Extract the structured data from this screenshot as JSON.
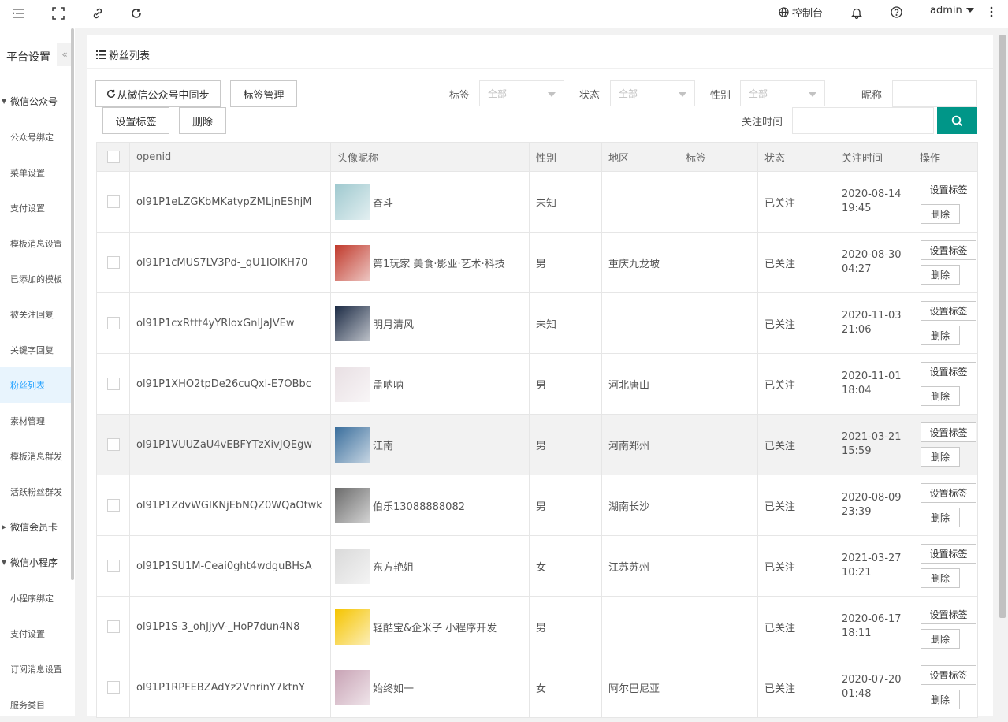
{
  "topbar": {
    "console": "控制台",
    "user": "admin"
  },
  "sidebar": {
    "title": "平台设置",
    "groups": [
      {
        "label": "微信公众号",
        "items": [
          "公众号绑定",
          "菜单设置",
          "支付设置",
          "模板消息设置",
          "已添加的模板",
          "被关注回复",
          "关键字回复",
          "粉丝列表",
          "素材管理",
          "模板消息群发",
          "活跃粉丝群发"
        ]
      },
      {
        "label": "微信会员卡",
        "items": []
      },
      {
        "label": "微信小程序",
        "items": [
          "小程序绑定",
          "支付设置",
          "订阅消息设置",
          "服务类目"
        ]
      }
    ],
    "active": "粉丝列表"
  },
  "panel": {
    "title": "粉丝列表"
  },
  "toolbar": {
    "sync": "从微信公众号中同步",
    "tag_manage": "标签管理",
    "set_tag": "设置标签",
    "delete": "删除"
  },
  "filters": {
    "tag_label": "标签",
    "tag_value": "全部",
    "status_label": "状态",
    "status_value": "全部",
    "gender_label": "性别",
    "gender_value": "全部",
    "nickname_label": "昵称",
    "follow_time_label": "关注时间"
  },
  "table": {
    "headers": [
      "openid",
      "头像昵称",
      "性别",
      "地区",
      "标签",
      "状态",
      "关注时间",
      "操作"
    ],
    "op_set_tag": "设置标签",
    "op_delete": "删除",
    "rows": [
      {
        "openid": "ol91P1eLZGKbMKatypZMLjnEShjM",
        "nickname": "奋斗",
        "gender": "未知",
        "region": "",
        "tag": "",
        "status": "已关注",
        "time": "2020-08-14 19:45",
        "avatar_color": "#9fc9cf"
      },
      {
        "openid": "ol91P1cMUS7LV3Pd-_qU1IOlKH70",
        "nickname": "第1玩家 美食·影业·艺术·科技",
        "gender": "男",
        "region": "重庆九龙坡",
        "tag": "",
        "status": "已关注",
        "time": "2020-08-30 04:27",
        "avatar_color": "#c0392b"
      },
      {
        "openid": "ol91P1cxRttt4yYRloxGnlJaJVEw",
        "nickname": "明月清风",
        "gender": "未知",
        "region": "",
        "tag": "",
        "status": "已关注",
        "time": "2020-11-03 21:06",
        "avatar_color": "#1b2a44"
      },
      {
        "openid": "ol91P1XHO2tpDe26cuQxl-E7OBbc",
        "nickname": "孟呐呐",
        "gender": "男",
        "region": "河北唐山",
        "tag": "",
        "status": "已关注",
        "time": "2020-11-01 18:04",
        "avatar_color": "#e8dfe3"
      },
      {
        "openid": "ol91P1VUUZaU4vEBFYTzXivJQEgw",
        "nickname": "江南",
        "gender": "男",
        "region": "河南郑州",
        "tag": "",
        "status": "已关注",
        "time": "2021-03-21 15:59",
        "avatar_color": "#3a6e9c"
      },
      {
        "openid": "ol91P1ZdvWGIKNjEbNQZ0WQaOtwk",
        "nickname": "伯乐13088888082",
        "gender": "男",
        "region": "湖南长沙",
        "tag": "",
        "status": "已关注",
        "time": "2020-08-09 23:39",
        "avatar_color": "#6b6b6b"
      },
      {
        "openid": "ol91P1SU1M-Ceai0ght4wdguBHsA",
        "nickname": "东方艳姐",
        "gender": "女",
        "region": "江苏苏州",
        "tag": "",
        "status": "已关注",
        "time": "2021-03-27 10:21",
        "avatar_color": "#d9d9d9"
      },
      {
        "openid": "ol91P1S-3_ohJjyV-_HoP7dun4N8",
        "nickname": "轻酷宝&企米子 小程序开发",
        "gender": "男",
        "region": "",
        "tag": "",
        "status": "已关注",
        "time": "2020-06-17 18:11",
        "avatar_color": "#f5c400"
      },
      {
        "openid": "ol91P1RPFEBZAdYz2VnrinY7ktnY",
        "nickname": "始终如一",
        "gender": "女",
        "region": "阿尔巴尼亚",
        "tag": "",
        "status": "已关注",
        "time": "2020-07-20 01:48",
        "avatar_color": "#c8a3b5"
      }
    ]
  }
}
